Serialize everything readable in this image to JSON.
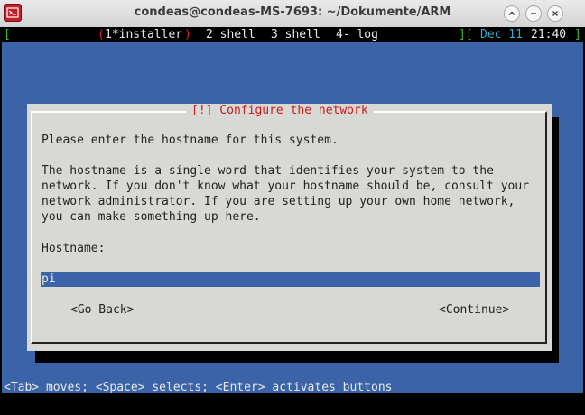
{
  "window": {
    "title": "condeas@condeas-MS-7693: ~/Dokumente/ARM",
    "buttons": {
      "maximize_icon": "chevron-up-icon",
      "minimize_icon": "minimize-icon",
      "close_icon": "close-icon"
    }
  },
  "statusbar": {
    "left_bracket": "[",
    "window_num_open": "(",
    "active_window": "1*installer",
    "window_num_close": ")",
    "windows": [
      "2 shell",
      "3 shell",
      "4- log"
    ],
    "right_bracket_open": "][",
    "date": "Dec 11",
    "time": "21:40",
    "right_bracket_close": "]"
  },
  "dialog": {
    "title": "[!] Configure the network",
    "prompt": "Please enter the hostname for this system.",
    "description_lines": [
      "The hostname is a single word that identifies your system to the",
      "network. If you don't know what your hostname should be, consult your",
      "network administrator. If you are setting up your own home network,",
      "you can make something up here."
    ],
    "field_label": "Hostname:",
    "field_value": "pi",
    "back_button": "<Go Back>",
    "continue_button": "<Continue>"
  },
  "help_text": "<Tab> moves; <Space> selects; <Enter> activates buttons",
  "colors": {
    "background_blue": "#3b64a8",
    "dialog_grey": "#d8d8d4",
    "title_red": "#c51c1c",
    "status_green": "#3ab43a",
    "status_cyan": "#3aa6c8"
  }
}
